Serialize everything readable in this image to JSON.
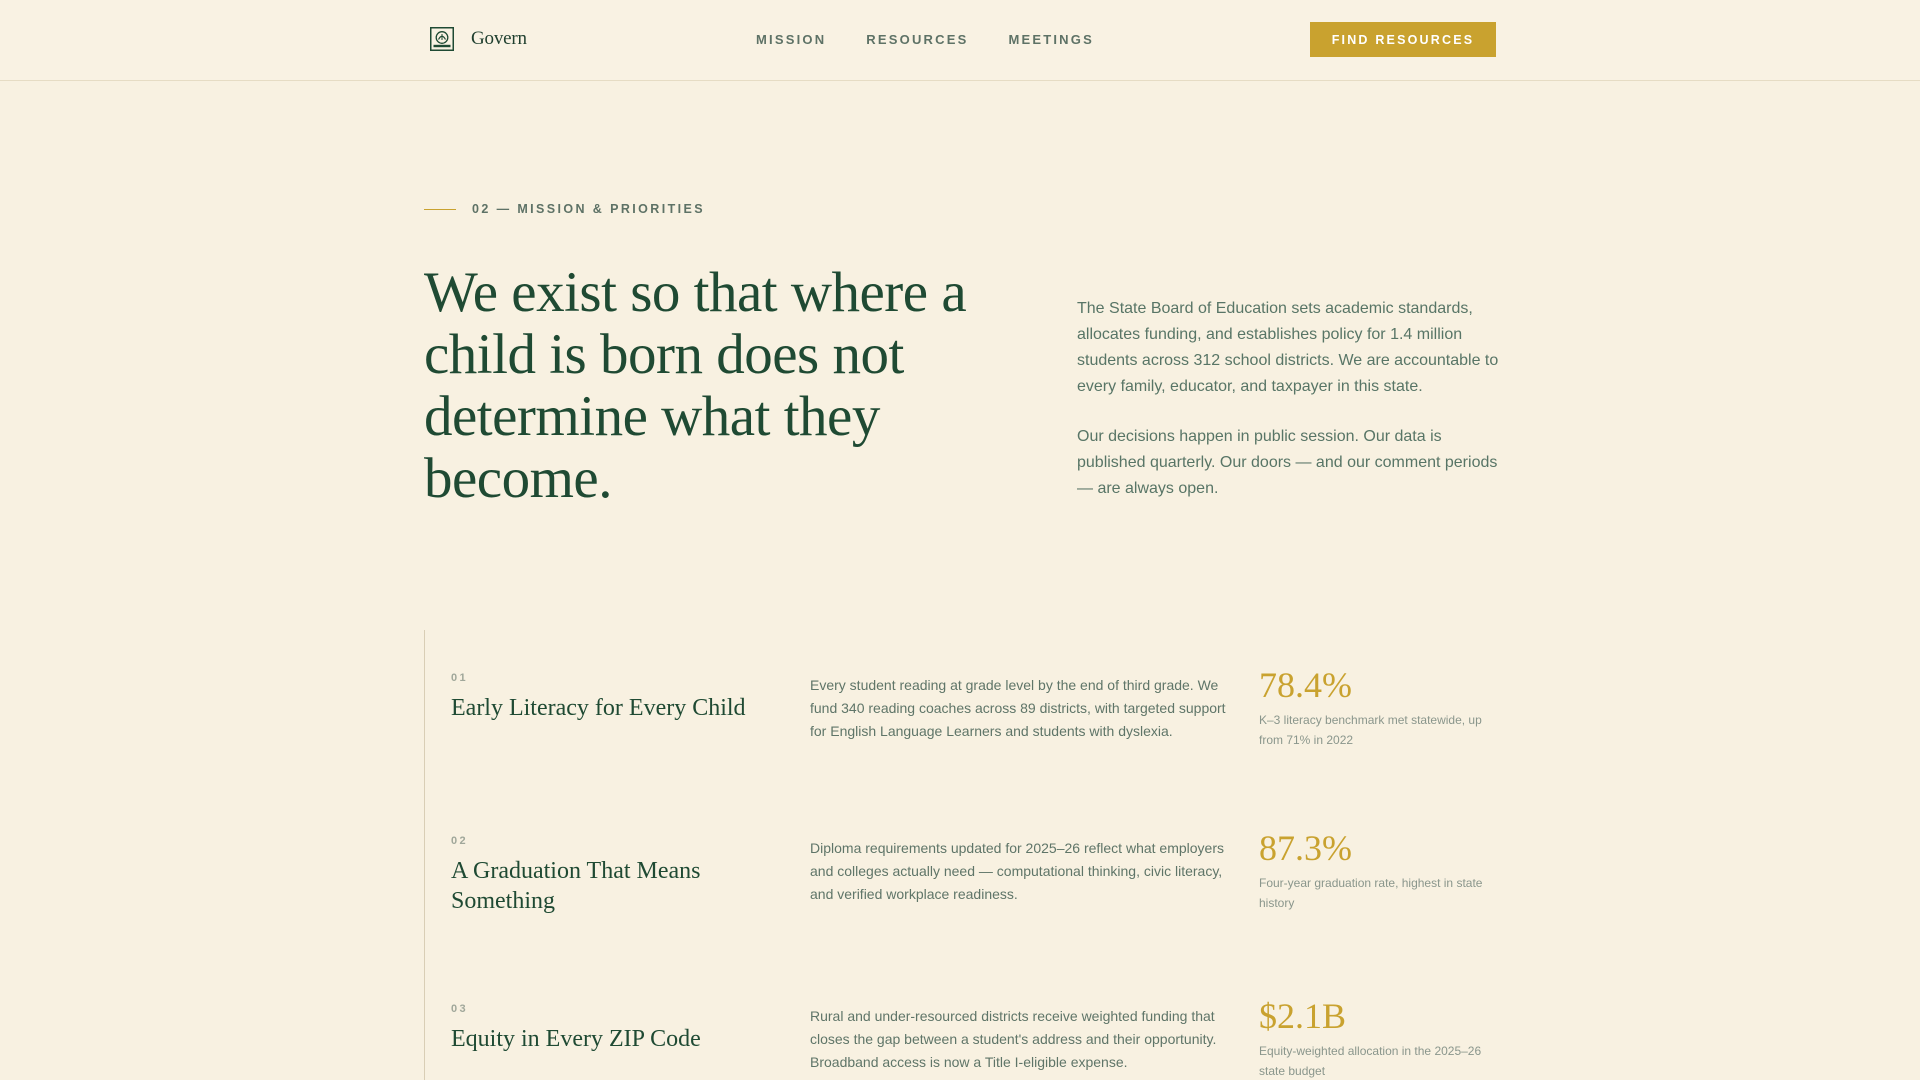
{
  "header": {
    "brand_name": "Govern",
    "brand_icon": "seal-icon",
    "nav": [
      "MISSION",
      "RESOURCES",
      "MEETINGS"
    ],
    "cta_label": "FIND RESOURCES"
  },
  "hero": {
    "eyebrow": "02 — MISSION & PRIORITIES",
    "headline": "We exist so that where a child is born does not determine what they become.",
    "intro": [
      "The State Board of Education sets academic standards, allocates funding, and establishes policy for 1.4 million students across 312 school districts. We are accountable to every family, educator, and taxpayer in this state.",
      "Our decisions happen in public session. Our data is published quarterly. Our doors — and our comment periods — are always open."
    ]
  },
  "priorities": [
    {
      "number": "01",
      "title": "Early Literacy for Every Child",
      "description": "Every student reading at grade level by the end of third grade. We fund 340 reading coaches across 89 districts, with targeted support for English Language Learners and students with dyslexia.",
      "stat_value": "78.4%",
      "stat_label": "K–3 literacy benchmark met statewide, up from 71% in 2022"
    },
    {
      "number": "02",
      "title": "A Graduation That Means Something",
      "description": "Diploma requirements updated for 2025–26 reflect what employers and colleges actually need — computational thinking, civic literacy, and verified workplace readiness.",
      "stat_value": "87.3%",
      "stat_label": "Four-year graduation rate, highest in state history"
    },
    {
      "number": "03",
      "title": "Equity in Every ZIP Code",
      "description": "Rural and under-resourced districts receive weighted funding that closes the gap between a student's address and their opportunity. Broadband access is now a Title I-eligible expense.",
      "stat_value": "$2.1B",
      "stat_label": "Equity-weighted allocation in the 2025–26 state budget"
    }
  ],
  "colors": {
    "background": "#f8f1e1",
    "primary_green": "#1f4a33",
    "accent_gold": "#c9a22f"
  }
}
